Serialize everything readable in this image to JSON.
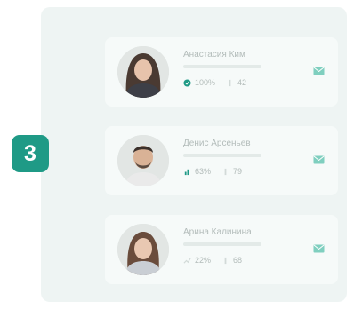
{
  "step": {
    "number": "3"
  },
  "employees": [
    {
      "name": "Анастасия Ким",
      "completion": "100%",
      "count": "42",
      "gender": "f"
    },
    {
      "name": "Денис Арсеньев",
      "completion": "63%",
      "count": "79",
      "gender": "m"
    },
    {
      "name": "Арина Калинина",
      "completion": "22%",
      "count": "68",
      "gender": "f"
    }
  ],
  "colors": {
    "accent": "#1f9a86",
    "panel": "#eef4f3",
    "mail": "#7fcfbf"
  },
  "icons": {
    "completion_1": "check-circle-icon",
    "completion_2": "chart-icon",
    "completion_3": "trend-icon",
    "count": "list-icon",
    "action": "mail-icon"
  }
}
